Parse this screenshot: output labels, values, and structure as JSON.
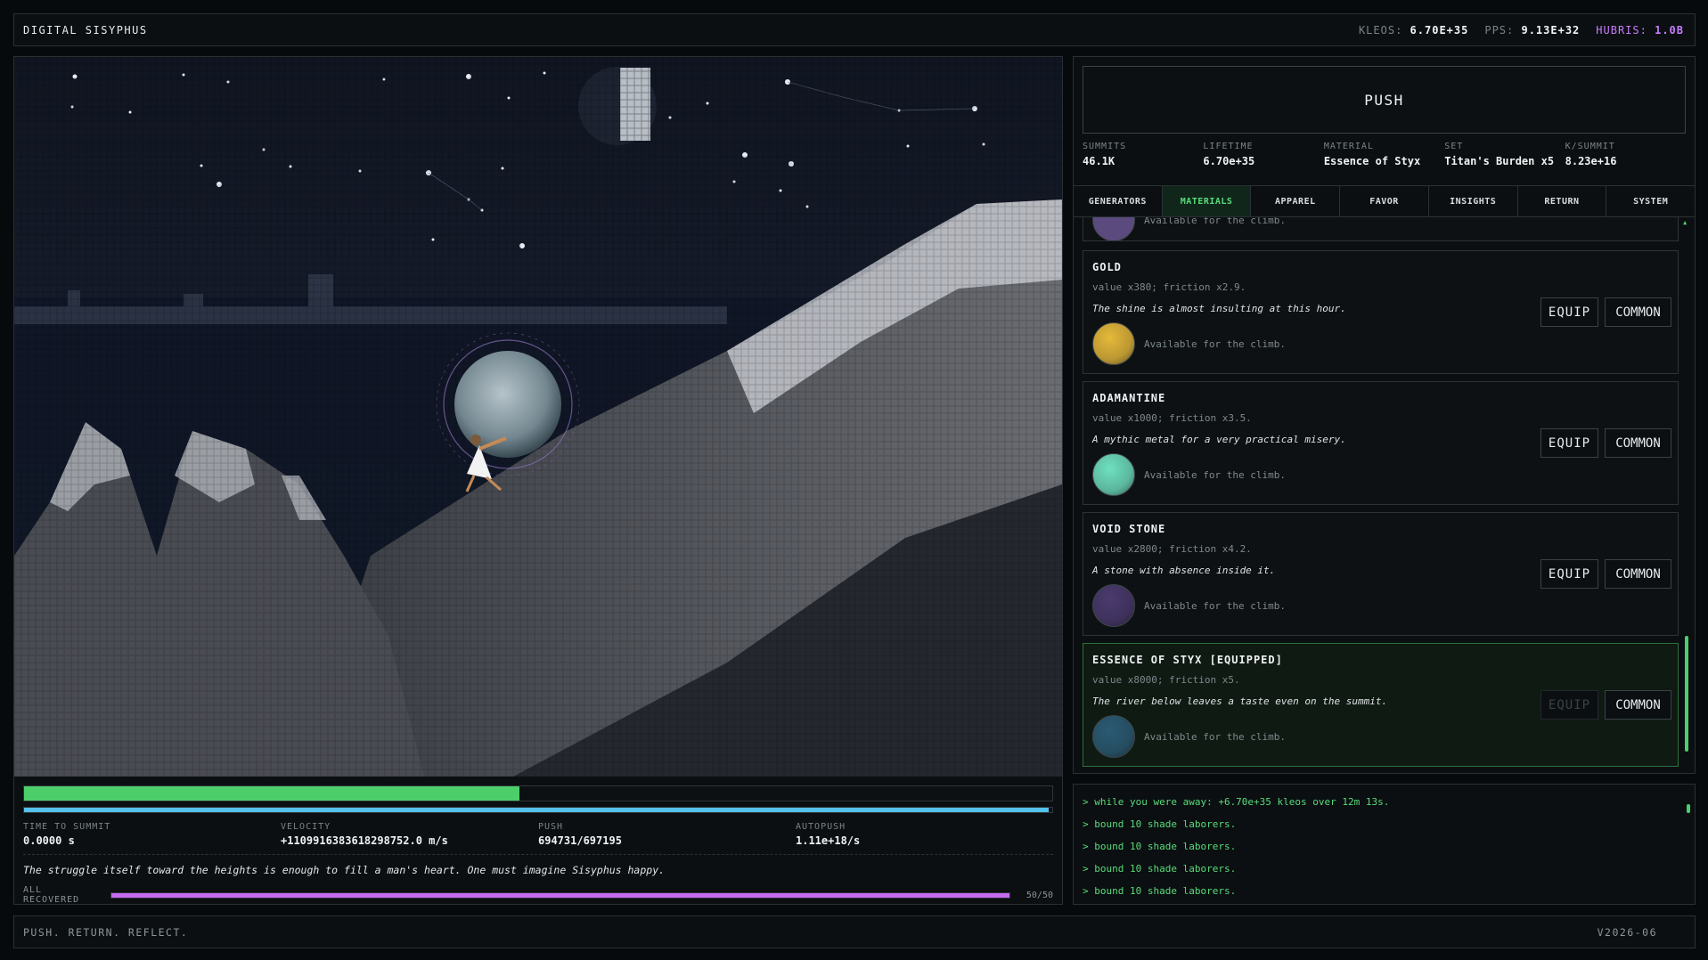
{
  "header": {
    "brand": "DIGITAL SISYPHUS",
    "stats": [
      {
        "label": "KLEOS:",
        "value": "6.70E+35"
      },
      {
        "label": "PPS:",
        "value": "9.13E+32"
      },
      {
        "label": "HUBRIS:",
        "value": "1.0B"
      }
    ]
  },
  "game": {
    "summit_progress": 0.482,
    "push_progress": 0.9966,
    "metrics": [
      {
        "label": "TIME TO SUMMIT",
        "value": "0.0000 s"
      },
      {
        "label": "VELOCITY",
        "value": "+1109916383618298752.0 m/s"
      },
      {
        "label": "PUSH",
        "value": "694731/697195"
      },
      {
        "label": "AUTOPUSH",
        "value": "1.11e+18/s"
      }
    ],
    "quote": "The struggle itself toward the heights is enough to fill a man's heart. One must imagine Sisyphus happy.",
    "recovered": {
      "label": "ALL RECOVERED",
      "count": "50/50",
      "progress": 1.0
    }
  },
  "panel": {
    "push_label": "PUSH",
    "summary": [
      {
        "label": "SUMMITS",
        "value": "46.1K"
      },
      {
        "label": "LIFETIME",
        "value": "6.70e+35"
      },
      {
        "label": "MATERIAL",
        "value": "Essence of Styx"
      },
      {
        "label": "SET",
        "value": "Titan's Burden x5"
      },
      {
        "label": "K/SUMMIT",
        "value": "8.23e+16"
      }
    ],
    "tabs": [
      "GENERATORS",
      "MATERIALS",
      "APPAREL",
      "FAVOR",
      "INSIGHTS",
      "RETURN",
      "SYSTEM"
    ],
    "active_tab": "MATERIALS",
    "materials": [
      {
        "name": "GOLD",
        "stat": "value x380; friction x2.9.",
        "desc": "The shine is almost insulting at this hour.",
        "avail": "Available for the climb.",
        "equip": "EQUIP",
        "rarity": "COMMON",
        "color": "#e6b93a",
        "equipped": false
      },
      {
        "name": "ADAMANTINE",
        "stat": "value x1000; friction x3.5.",
        "desc": "A mythic metal for a very practical misery.",
        "avail": "Available for the climb.",
        "equip": "EQUIP",
        "rarity": "COMMON",
        "color": "#6fe0c0",
        "equipped": false
      },
      {
        "name": "VOID STONE",
        "stat": "value x2800; friction x4.2.",
        "desc": "A stone with absence inside it.",
        "avail": "Available for the climb.",
        "equip": "EQUIP",
        "rarity": "COMMON",
        "color": "#4a3a6e",
        "equipped": false
      },
      {
        "name": "ESSENCE OF STYX [EQUIPPED]",
        "stat": "value x8000; friction x5.",
        "desc": "The river below leaves a taste even on the summit.",
        "avail": "Available for the climb.",
        "equip": "EQUIP",
        "rarity": "COMMON",
        "color": "#2b5a74",
        "equipped": true
      }
    ],
    "partial_stub_text": "Available for the climb."
  },
  "log": [
    "> while you were away: +6.70e+35 kleos over 12m 13s.",
    "> bound 10 shade laborers.",
    "> bound 10 shade laborers.",
    "> bound 10 shade laborers.",
    "> bound 10 shade laborers."
  ],
  "footer": {
    "left": "PUSH. RETURN. REFLECT.",
    "right": "V2026-06"
  },
  "colors": {
    "accent_green": "#4ccf6b",
    "accent_blue": "#56c2ec",
    "accent_purple": "#c56bf0",
    "hubris": "#c77dff"
  }
}
